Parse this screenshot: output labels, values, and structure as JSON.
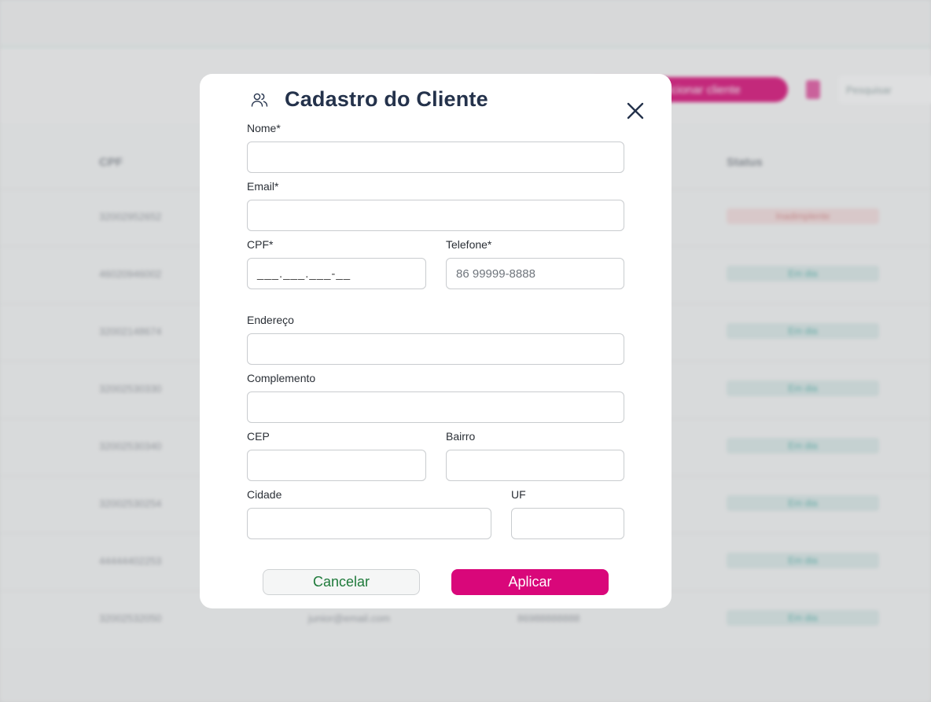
{
  "background": {
    "add_button_label": "Adicionar cliente",
    "search_placeholder": "Pesquisar",
    "columns": [
      "CPF",
      "Status"
    ],
    "rows": [
      {
        "cpf": "32002952652",
        "status": "Inadimplente",
        "status_type": "bad"
      },
      {
        "cpf": "46020946002",
        "status": "Em dia",
        "status_type": "ok"
      },
      {
        "cpf": "32002148674",
        "status": "Em dia",
        "status_type": "ok"
      },
      {
        "cpf": "32002530330",
        "status": "Em dia",
        "status_type": "ok"
      },
      {
        "cpf": "32002530340",
        "status": "Em dia",
        "status_type": "ok"
      },
      {
        "cpf": "32002530254",
        "status": "Em dia",
        "status_type": "ok"
      },
      {
        "cpf": "44444402253",
        "status": "Em dia",
        "status_type": "ok"
      },
      {
        "cpf": "32002532050",
        "status": "Em dia",
        "status_type": "ok",
        "email": "junior@email.com",
        "phone": "86988888888"
      }
    ]
  },
  "modal": {
    "title": "Cadastro do Cliente",
    "title_icon": "users-icon",
    "close_icon": "close-icon",
    "fields": {
      "nome": {
        "label": "Nome*",
        "value": "",
        "placeholder": ""
      },
      "email": {
        "label": "Email*",
        "value": "",
        "placeholder": ""
      },
      "cpf": {
        "label": "CPF*",
        "value": "___.___.___-__",
        "placeholder": ""
      },
      "telefone": {
        "label": "Telefone*",
        "value": "",
        "placeholder": "86 99999-8888"
      },
      "endereco": {
        "label": "Endereço",
        "value": "",
        "placeholder": ""
      },
      "complemento": {
        "label": "Complemento",
        "value": "",
        "placeholder": ""
      },
      "cep": {
        "label": "CEP",
        "value": "",
        "placeholder": ""
      },
      "bairro": {
        "label": "Bairro",
        "value": "",
        "placeholder": ""
      },
      "cidade": {
        "label": "Cidade",
        "value": "",
        "placeholder": ""
      },
      "uf": {
        "label": "UF",
        "value": "",
        "placeholder": ""
      }
    },
    "buttons": {
      "cancel": "Cancelar",
      "apply": "Aplicar"
    }
  },
  "colors": {
    "accent": "#d9077a",
    "title": "#24324b",
    "cancel_text": "#1e7a3a"
  }
}
